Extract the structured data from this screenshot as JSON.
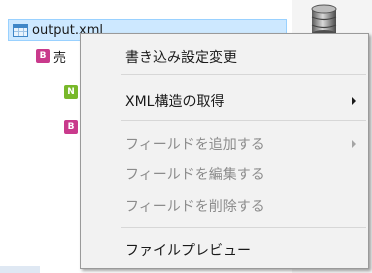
{
  "tree": {
    "root_label": "output.xml",
    "child_label": "売",
    "child_badge": "B",
    "sub_badges": [
      "N",
      "B"
    ]
  },
  "context_menu": {
    "items": [
      {
        "label": "書き込み設定変更",
        "enabled": true,
        "submenu": false
      },
      {
        "label": "XML構造の取得",
        "enabled": true,
        "submenu": true
      },
      {
        "label": "フィールドを追加する",
        "enabled": false,
        "submenu": true
      },
      {
        "label": "フィールドを編集する",
        "enabled": false,
        "submenu": false
      },
      {
        "label": "フィールドを削除する",
        "enabled": false,
        "submenu": false
      },
      {
        "label": "ファイルプレビュー",
        "enabled": true,
        "submenu": false
      }
    ]
  },
  "colors": {
    "selection_bg": "#cde8ff",
    "badge_pink": "#c93a8c",
    "badge_green": "#78b82a",
    "menu_bg": "#f2f2f2"
  },
  "icons": {
    "root": "table-icon",
    "database": "database-icon",
    "submenu": "submenu-arrow-icon"
  }
}
